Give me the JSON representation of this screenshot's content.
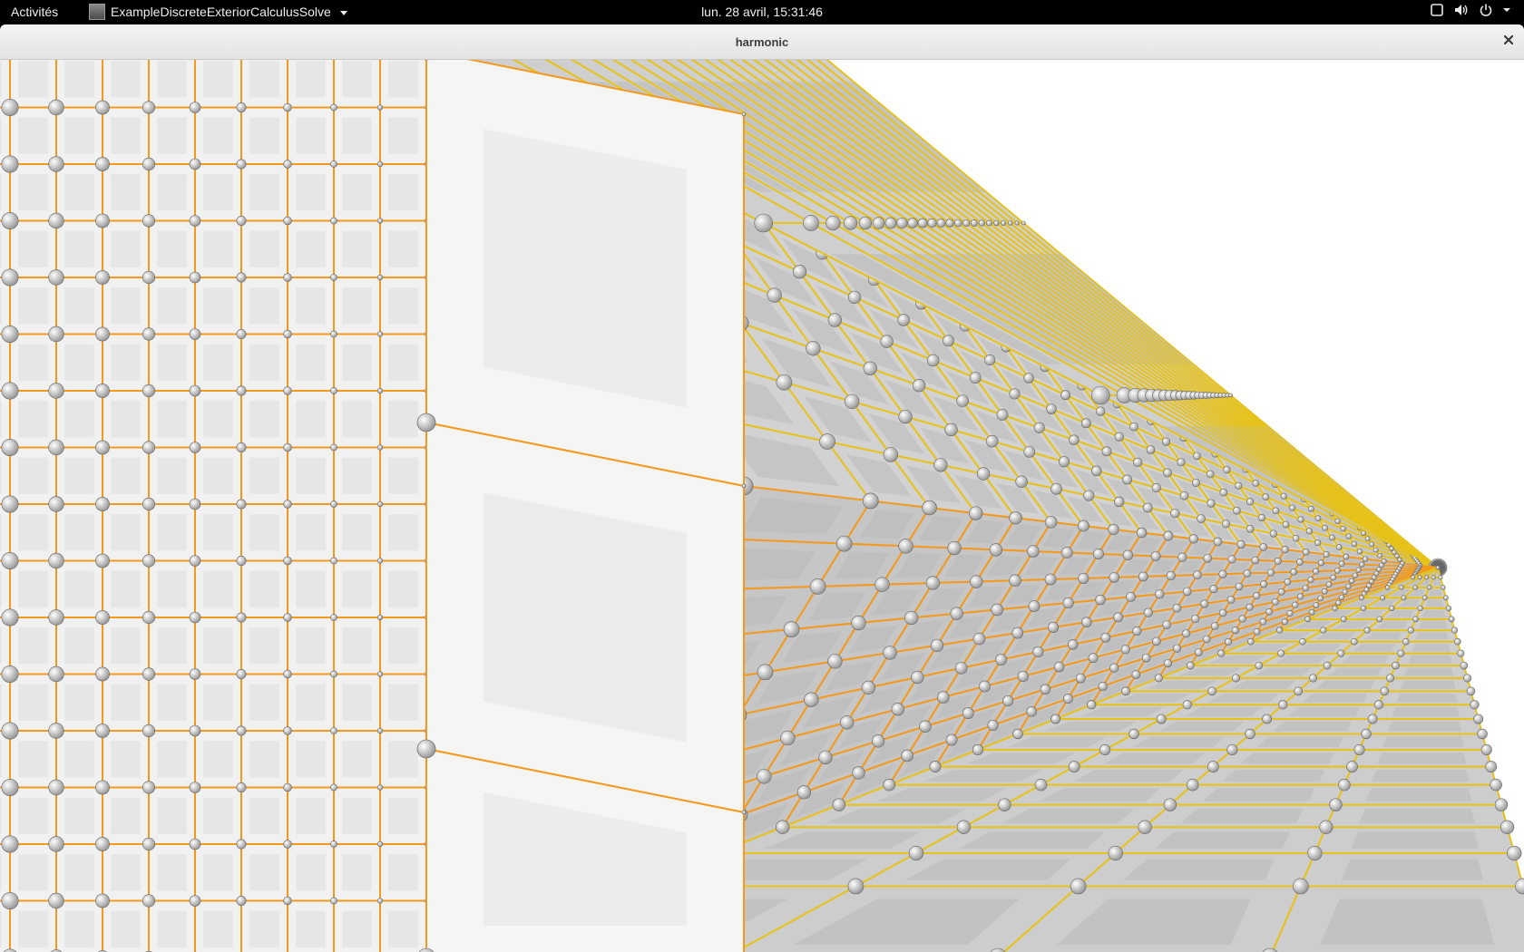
{
  "topbar": {
    "activities_label": "Activités",
    "app_name": "ExampleDiscreteExteriorCalculusSolve",
    "clock": "lun. 28 avril, 15:31:46",
    "tray_icons": [
      "screen-icon",
      "volume-icon",
      "power-icon"
    ]
  },
  "window": {
    "title": "harmonic",
    "close_glyph": "×"
  },
  "viewport": {
    "description_icon": "3d-render-canvas",
    "colors": {
      "background": "#ffffff",
      "face_light": "#f1f1f1",
      "face_dark": "#b9b9b9",
      "edge_orange": "#f39a1e",
      "edge_yellow": "#e6c21a",
      "vertex": "#ffffff"
    }
  }
}
